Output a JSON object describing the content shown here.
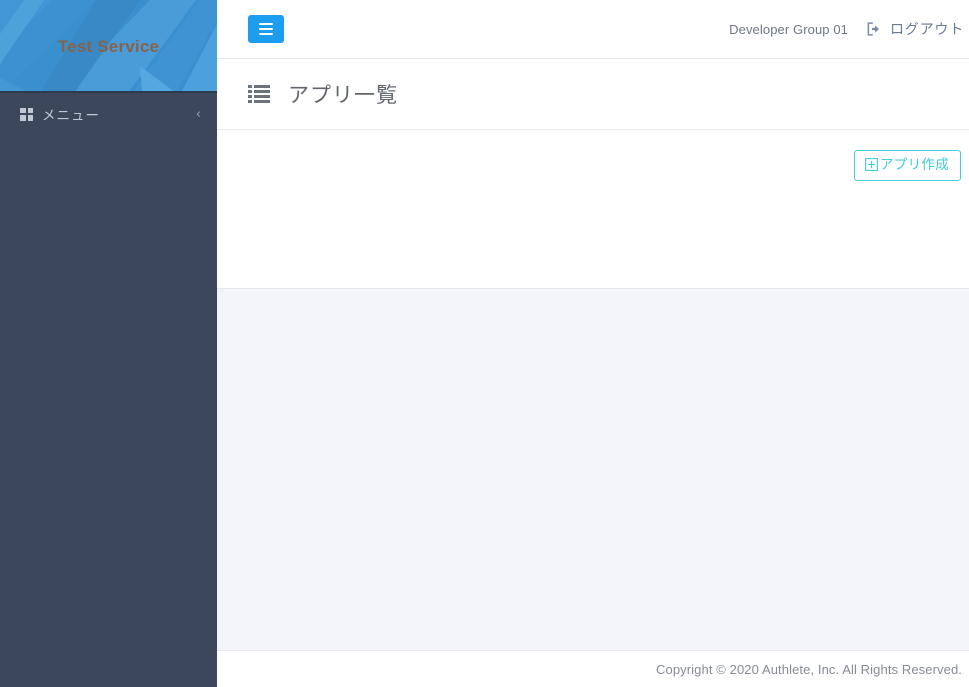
{
  "brand": {
    "title": "Test Service",
    "title_color": "#87634a",
    "header_bg": "#3a8fce"
  },
  "sidebar": {
    "bg_color": "#3d475c",
    "menu": {
      "label": "メニュー",
      "icon": "grid-icon",
      "collapse_icon": "chevron-left-icon",
      "collapse_glyph": "‹"
    }
  },
  "navbar": {
    "toggle_icon": "hamburger-icon",
    "toggle_bg": "#1b9df0",
    "user_label": "Developer Group 01",
    "logout": {
      "label": "ログアウト",
      "icon": "sign-out-icon",
      "color": "#6b7a93"
    }
  },
  "page": {
    "icon": "list-icon",
    "title": "アプリ一覧",
    "title_color": "#62676e"
  },
  "main": {
    "create_button": {
      "label": "アプリ作成",
      "icon": "plus-square-icon",
      "accent_color": "#41cfd8"
    },
    "background_color": "#f4f5f9"
  },
  "footer": {
    "copyright": "Copyright © 2020 Authlete, Inc. All Rights Reserved."
  }
}
